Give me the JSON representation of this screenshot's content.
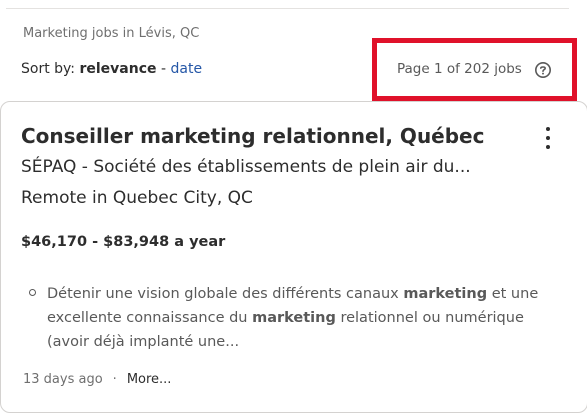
{
  "search": {
    "context": "Marketing jobs in Lévis, QC"
  },
  "sort": {
    "label": "Sort by:",
    "active": "relevance",
    "separator": "-",
    "alternate": "date"
  },
  "pagination": {
    "text": "Page 1 of 202 jobs"
  },
  "job": {
    "title": "Conseiller marketing relationnel, Québec",
    "company": "SÉPAQ - Société des établissements de plein air du...",
    "location": "Remote in Quebec City, QC",
    "salary": "$46,170 - $83,948 a year",
    "snippet": {
      "part1": "Détenir une vision globale des différents canaux ",
      "kw1": "marketing",
      "part2": " et une excellente connaissance du ",
      "kw2": "marketing",
      "part3": " relationnel ou numérique (avoir déjà implanté une..."
    },
    "posted": "13 days ago",
    "separator": "·",
    "more": "More..."
  },
  "colors": {
    "highlight": "#e0112a",
    "link": "#2557a7",
    "text": "#2d2d2d",
    "muted": "#595959"
  },
  "icons": {
    "help": "help-circle-icon",
    "menu": "kebab-menu-icon",
    "bullet": "bullet-circle-icon"
  }
}
